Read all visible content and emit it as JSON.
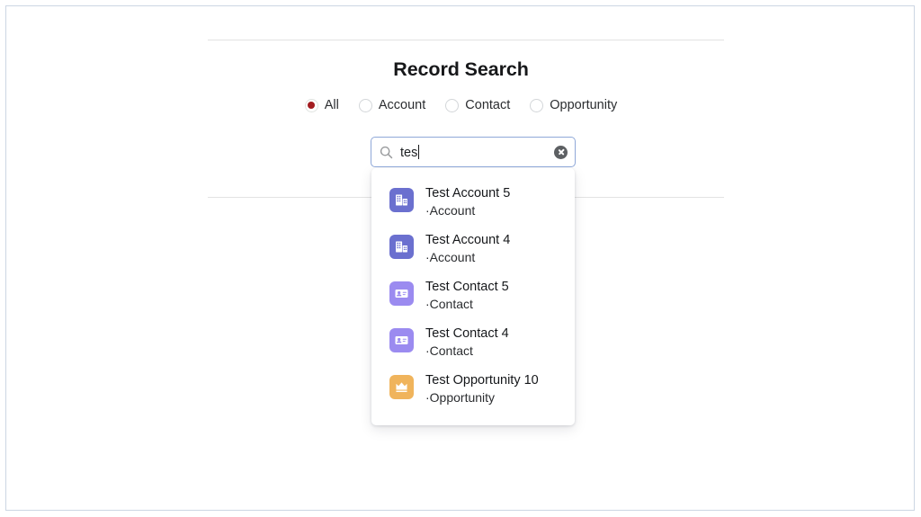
{
  "page": {
    "title": "Record Search"
  },
  "filters": {
    "options": [
      {
        "label": "All",
        "selected": true
      },
      {
        "label": "Account",
        "selected": false
      },
      {
        "label": "Contact",
        "selected": false
      },
      {
        "label": "Opportunity",
        "selected": false
      }
    ]
  },
  "search": {
    "value": "tes",
    "placeholder": "",
    "search_icon": "search-icon",
    "clear_icon": "clear-circle-icon"
  },
  "results": [
    {
      "title": "Test Account 5",
      "subtitle": "·Account",
      "icon": "account-building-icon",
      "icon_color": "#6b70cf"
    },
    {
      "title": "Test Account 4",
      "subtitle": "·Account",
      "icon": "account-building-icon",
      "icon_color": "#6b70cf"
    },
    {
      "title": "Test Contact 5",
      "subtitle": "·Contact",
      "icon": "contact-card-icon",
      "icon_color": "#9b8bf0"
    },
    {
      "title": "Test Contact 4",
      "subtitle": "·Contact",
      "icon": "contact-card-icon",
      "icon_color": "#9b8bf0"
    },
    {
      "title": "Test Opportunity 10",
      "subtitle": "·Opportunity",
      "icon": "opportunity-crown-icon",
      "icon_color": "#f0b45c"
    }
  ],
  "colors": {
    "radio_selected": "#a31c20",
    "input_focus_border": "#8fa8d8",
    "rule": "#e3e3e3",
    "frame_border": "#ccd6e3"
  }
}
